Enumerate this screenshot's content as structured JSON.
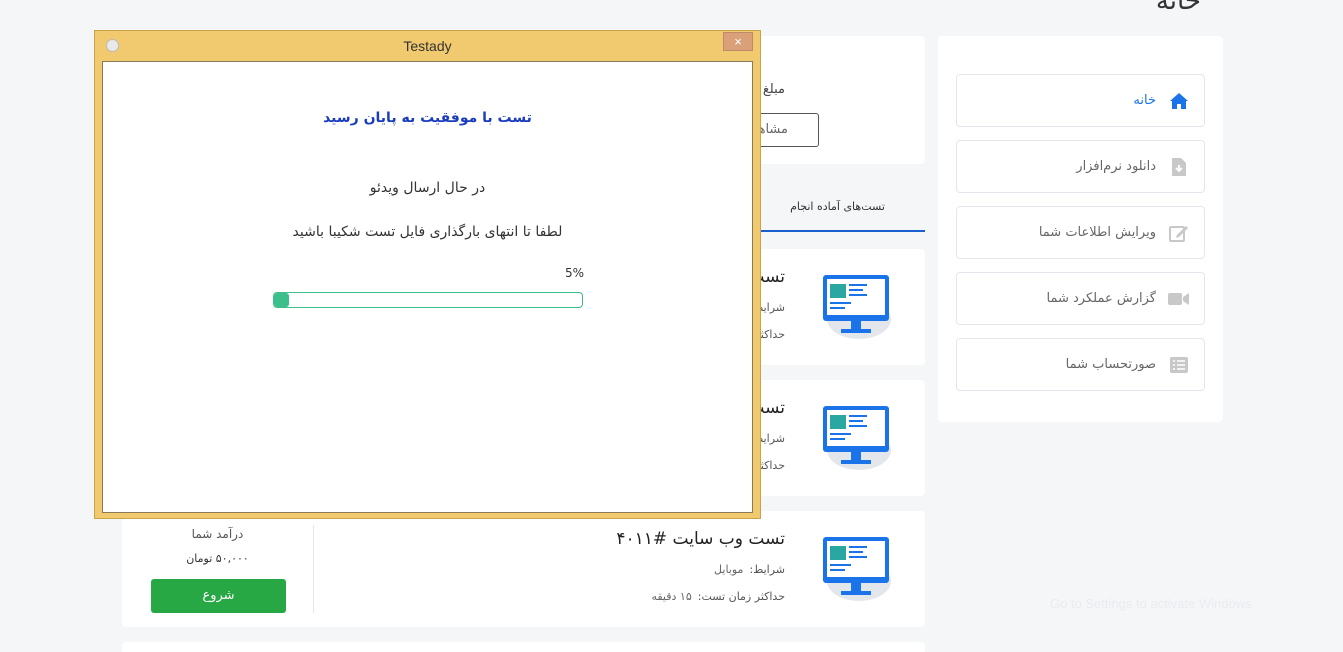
{
  "page": {
    "title": "خانه"
  },
  "sidebar": {
    "items": [
      {
        "label": "خانه",
        "icon": "home-icon",
        "active": true
      },
      {
        "label": "دانلود نرم‌افزار",
        "icon": "file-download-icon",
        "active": false
      },
      {
        "label": "ویرایش اطلاعات شما",
        "icon": "edit-icon",
        "active": false
      },
      {
        "label": "گزارش عملکرد شما",
        "icon": "video-camera-icon",
        "active": false
      },
      {
        "label": "صورتحساب شما",
        "icon": "list-icon",
        "active": false
      }
    ]
  },
  "top_card": {
    "amount_label": "مبلغ",
    "view_button": "مشاهده"
  },
  "tabs": {
    "active_label": "تست‌های آماده انجام"
  },
  "cards": [
    {
      "title": "تست",
      "cond_label": "شرایط",
      "max_label": "حداکثر"
    },
    {
      "title": "تست",
      "cond_label": "شرایط",
      "max_label": "حداکثر"
    },
    {
      "title": "تست وب سایت #۴۰۱۱",
      "cond_label": "شرایط:",
      "cond_value": "موبایل",
      "max_label": "حداکثر زمان تست:",
      "max_value": "۱۵ دقیقه",
      "income_label": "درآمد شما",
      "income_value": "۵۰,۰۰۰ تومان",
      "start_button": "شروع"
    }
  ],
  "dialog": {
    "window_title": "Testady",
    "close_glyph": "×",
    "success_text": "تست با موفقیت به پایان رسید",
    "sending_text": "در حال ارسال ویدئو",
    "wait_text": "لطفا تا انتهای بارگذاری فایل تست شکیبا باشید",
    "progress_label": "5%",
    "progress": 0.05
  },
  "watermark": "Go to Settings to activate Windows",
  "colors": {
    "accent": "#1a73e8",
    "start_button": "#28a745",
    "progress": "#3cbf8a",
    "dialog_frame": "#f1c96e"
  }
}
